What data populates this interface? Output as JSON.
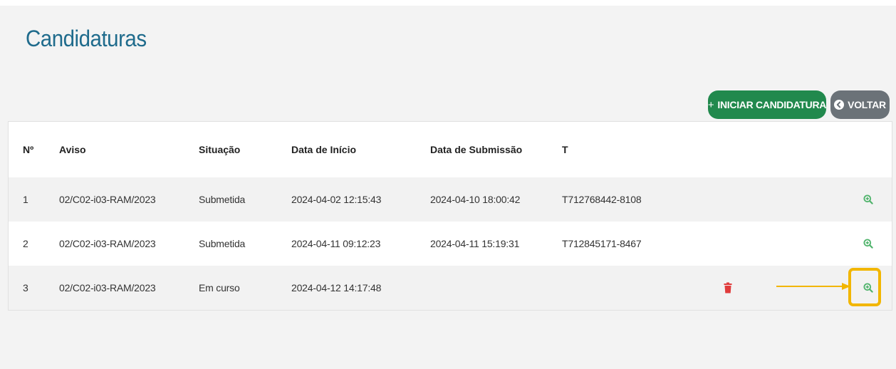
{
  "page": {
    "title": "Candidaturas"
  },
  "toolbar": {
    "start_plus": "+",
    "start_label": "INICIAR CANDIDATURA",
    "back_label": "VOLTAR"
  },
  "table": {
    "headers": [
      "Nº",
      "Aviso",
      "Situação",
      "Data de Início",
      "Data de Submissão",
      "T"
    ],
    "rows": [
      {
        "num": "1",
        "aviso": "02/C02-i03-RAM/2023",
        "situacao": "Submetida",
        "inicio": "2024-04-02 12:15:43",
        "submissao": "2024-04-10 18:00:42",
        "t": "T712768442-8108"
      },
      {
        "num": "2",
        "aviso": "02/C02-i03-RAM/2023",
        "situacao": "Submetida",
        "inicio": "2024-04-11 09:12:23",
        "submissao": "2024-04-11 15:19:31",
        "t": "T712845171-8467"
      },
      {
        "num": "3",
        "aviso": "02/C02-i03-RAM/2023",
        "situacao": "Em curso",
        "inicio": "2024-04-12 14:17:48",
        "submissao": "",
        "t": ""
      }
    ]
  },
  "icons": {
    "view": "zoom-in-icon",
    "delete": "trash-icon",
    "back": "circle-arrow-left-icon"
  },
  "colors": {
    "title": "#1f6b8c",
    "primary_button": "#21894d",
    "secondary_button": "#6b7278",
    "view_icon": "#4fb36b",
    "delete_icon": "#e03b3b",
    "highlight": "#f2b600"
  }
}
